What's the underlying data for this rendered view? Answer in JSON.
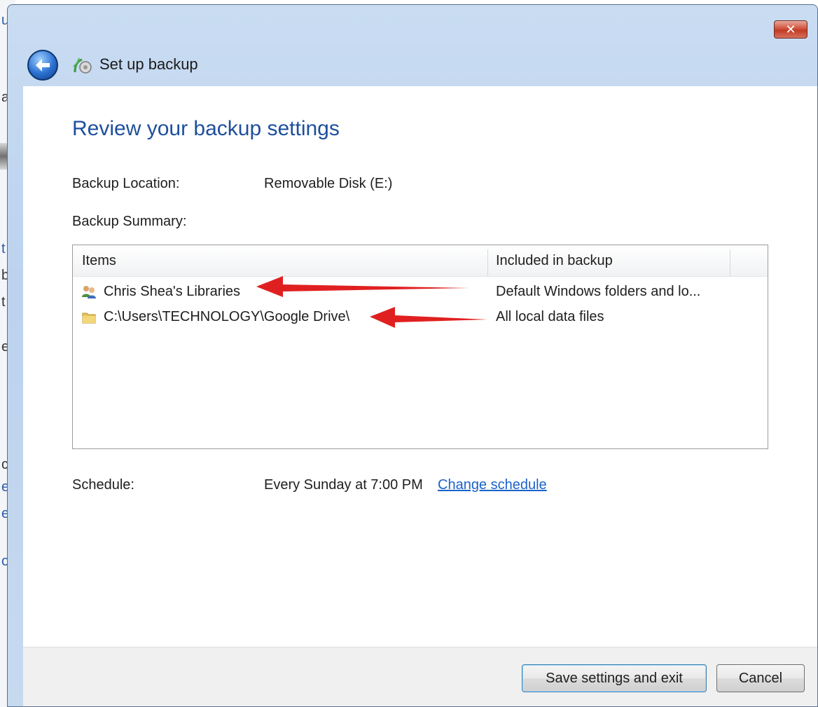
{
  "background_window": {
    "fragments": [
      "u",
      "at",
      "t",
      "b",
      "t",
      "e",
      "c",
      "e",
      "e",
      "o"
    ]
  },
  "window": {
    "title": "Set up backup",
    "close_label": "✕",
    "back_icon": "back-arrow-icon",
    "app_icon": "backup-icon"
  },
  "page": {
    "heading": "Review your backup settings",
    "location_label": "Backup Location:",
    "location_value": "Removable Disk (E:)",
    "summary_label": "Backup Summary:",
    "schedule_label": "Schedule:",
    "schedule_value": "Every Sunday at 7:00 PM",
    "change_schedule": "Change schedule"
  },
  "table": {
    "columns": [
      "Items",
      "Included in backup"
    ],
    "rows": [
      {
        "icon": "users-library-icon",
        "item": "Chris Shea's Libraries",
        "included": "Default Windows folders and lo..."
      },
      {
        "icon": "folder-icon",
        "item": "C:\\Users\\TECHNOLOGY\\Google Drive\\",
        "included": "All local data files"
      }
    ]
  },
  "annotations": {
    "arrow_color": "#e02020",
    "arrow_count": 2
  },
  "buttons": {
    "save": "Save settings and exit",
    "cancel": "Cancel"
  },
  "colors": {
    "heading": "#1e4f9c",
    "link": "#1a63c9",
    "close": "#c23a24"
  }
}
